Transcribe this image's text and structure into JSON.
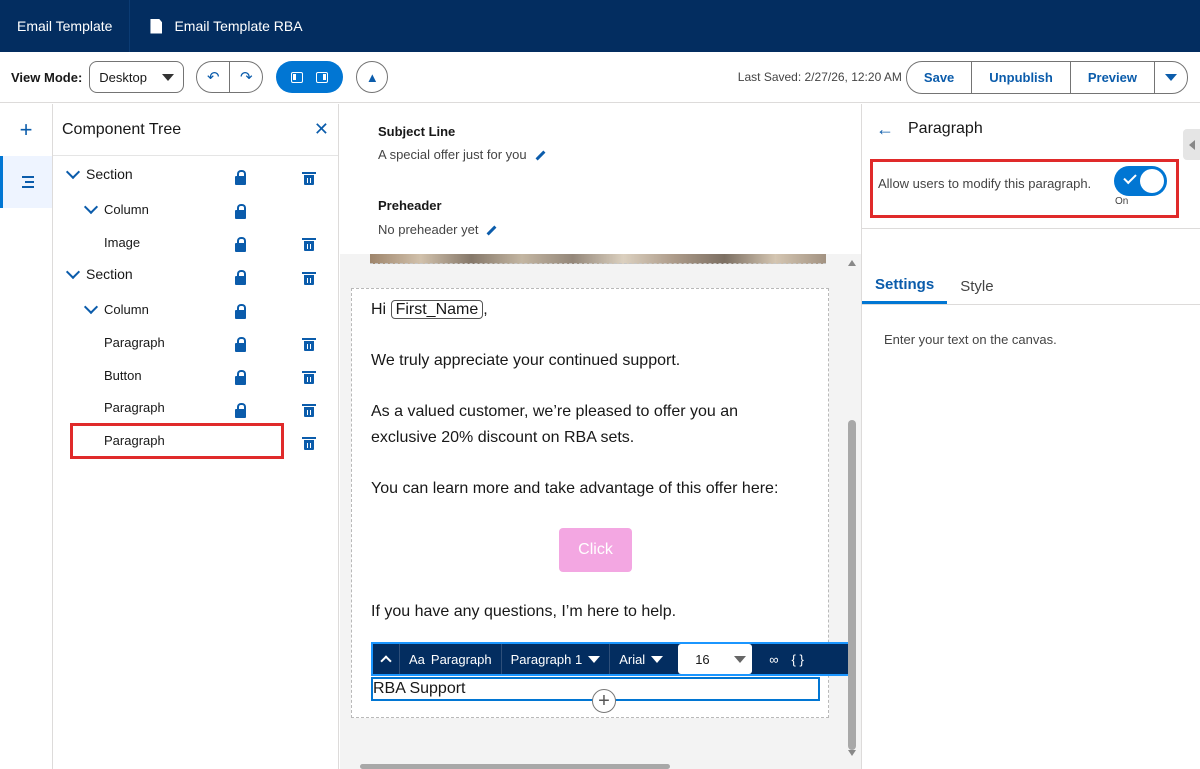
{
  "topbar": {
    "app_title": "Email Template",
    "document_title": "Email Template RBA"
  },
  "toolbar": {
    "view_mode_label": "View Mode:",
    "view_mode_value": "Desktop",
    "last_saved": "Last Saved: 2/27/26, 12:20 AM",
    "save_label": "Save",
    "unpublish_label": "Unpublish",
    "preview_label": "Preview"
  },
  "tree": {
    "title": "Component Tree",
    "nodes": [
      {
        "label": "Section"
      },
      {
        "label": "Column"
      },
      {
        "label": "Image"
      },
      {
        "label": "Section"
      },
      {
        "label": "Column"
      },
      {
        "label": "Paragraph"
      },
      {
        "label": "Button"
      },
      {
        "label": "Paragraph"
      },
      {
        "label": "Paragraph"
      }
    ]
  },
  "canvas": {
    "subject_label": "Subject Line",
    "subject_value": "A special offer just for you",
    "preheader_label": "Preheader",
    "preheader_value": "No preheader yet",
    "greeting_prefix": "Hi",
    "merge_field": "First_Name",
    "greeting_suffix": ",",
    "line1": "We truly appreciate your continued support.",
    "line2a": "As a valued customer, we’re pleased to offer you an",
    "line2b": "exclusive 20% discount on RBA sets.",
    "line3": "You can learn more and take advantage of this offer here:",
    "button_label": "Click",
    "line4": "If you have any questions, I’m here to help.",
    "signature": "RBA Support"
  },
  "rte": {
    "block_type": "Paragraph",
    "style": "Paragraph 1",
    "font": "Arial",
    "size": "16",
    "merge_icon": "{ }"
  },
  "props": {
    "title": "Paragraph",
    "allow_label": "Allow users to modify this paragraph.",
    "toggle_state": "On",
    "tab_settings": "Settings",
    "tab_style": "Style",
    "settings_hint": "Enter your text on the canvas."
  },
  "colors": {
    "topbar": "#032d60",
    "brand_blue": "#0176d3",
    "highlight_red": "#e02a2a",
    "cta_pink": "#f3a7e2"
  }
}
